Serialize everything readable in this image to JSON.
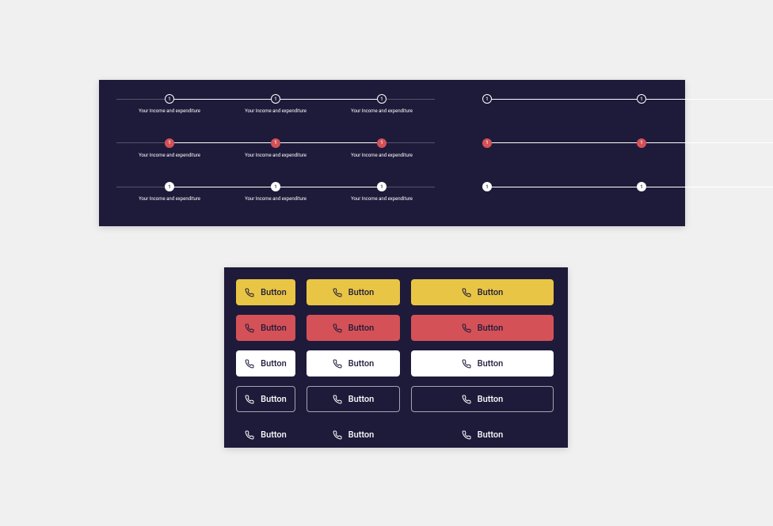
{
  "colors": {
    "panel_bg": "#1e1a3a",
    "yellow": "#e9c545",
    "red": "#d45158",
    "white": "#ffffff"
  },
  "steps": {
    "label": "Your Income and expenditure",
    "node_text": "1",
    "left_grid": [
      [
        "outline",
        "outline",
        "outline"
      ],
      [
        "red",
        "red",
        "red"
      ],
      [
        "white",
        "white",
        "white"
      ]
    ],
    "right_grid": [
      [
        "outline",
        "outline",
        "outline"
      ],
      [
        "red",
        "red",
        "red"
      ],
      [
        "white",
        "white",
        "white"
      ]
    ],
    "right_positions": [
      [
        "start",
        "center",
        "end"
      ],
      [
        "start",
        "center",
        "end"
      ],
      [
        "start",
        "center",
        "end"
      ]
    ]
  },
  "buttons": {
    "label": "Button",
    "rows": [
      {
        "variant": "yellow"
      },
      {
        "variant": "red"
      },
      {
        "variant": "white"
      },
      {
        "variant": "outline"
      },
      {
        "variant": "text"
      }
    ]
  }
}
